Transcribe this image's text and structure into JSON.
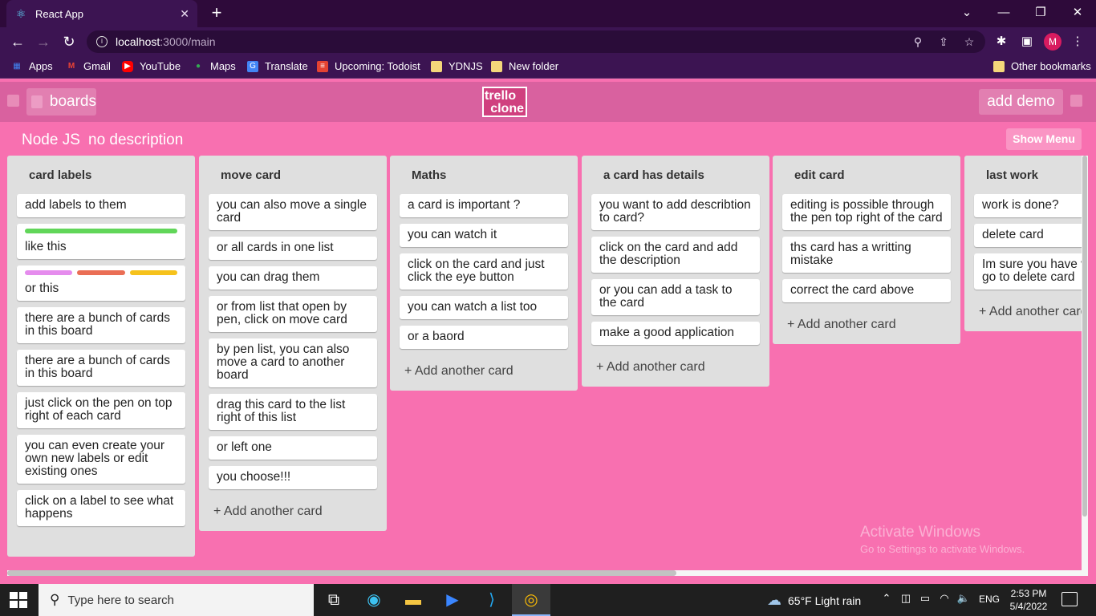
{
  "browser": {
    "tab_title": "React App",
    "url_host": "localhost",
    "url_path": ":3000/main",
    "profile_initial": "M"
  },
  "bookmarks": [
    {
      "label": "Apps",
      "icon": "apps-grid-icon",
      "color": "#4285f4"
    },
    {
      "label": "Gmail",
      "icon": "gmail-icon",
      "color": "#ea4335"
    },
    {
      "label": "YouTube",
      "icon": "youtube-icon",
      "color": "#ff0000"
    },
    {
      "label": "Maps",
      "icon": "maps-pin-icon",
      "color": "#34a853"
    },
    {
      "label": "Translate",
      "icon": "translate-icon",
      "color": "#4285f4"
    },
    {
      "label": "Upcoming: Todoist",
      "icon": "todoist-icon",
      "color": "#e44332"
    },
    {
      "label": "YDNJS",
      "icon": "folder-icon",
      "color": "#f4c542"
    },
    {
      "label": "New folder",
      "icon": "folder-icon",
      "color": "#f4c542"
    }
  ],
  "other_bookmarks": "Other bookmarks",
  "app": {
    "boards_label": "boards",
    "logo_line1": "trello",
    "logo_line2": "clone",
    "add_demo_label": "add demo",
    "board_name": "Node JS",
    "board_description": "no description",
    "show_menu_label": "Show Menu",
    "add_card_label": "+ Add another card"
  },
  "lists": [
    {
      "title": "card labels",
      "cards": [
        {
          "text": "add labels to them"
        },
        {
          "text": "like this",
          "labels": [
            "#61d659"
          ]
        },
        {
          "text": "or this",
          "labels": [
            "#e58ced",
            "#ea6e55",
            "#f6c21c"
          ]
        },
        {
          "text": "there are a bunch of cards in this board"
        },
        {
          "text": "there are a bunch of cards in this board"
        },
        {
          "text": "just click on the pen on top right of each card"
        },
        {
          "text": "you can even create your own new labels or edit existing ones"
        },
        {
          "text": "click on a label to see what happens"
        }
      ],
      "show_add": false
    },
    {
      "title": "move card",
      "cards": [
        {
          "text": "you can also move a single card"
        },
        {
          "text": "or all cards in one list"
        },
        {
          "text": "you can drag them"
        },
        {
          "text": "or from list that open by pen, click on move card"
        },
        {
          "text": "by pen list, you can also move a card to another board"
        },
        {
          "text": "drag this card to the list right of this list"
        },
        {
          "text": "or left one"
        },
        {
          "text": "you choose!!!"
        }
      ],
      "show_add": true
    },
    {
      "title": "Maths",
      "cards": [
        {
          "text": "a card is important ?"
        },
        {
          "text": "you can watch it"
        },
        {
          "text": "click on the card and just click the eye button"
        },
        {
          "text": "you can watch a list too"
        },
        {
          "text": "or a baord"
        }
      ],
      "show_add": true
    },
    {
      "title": "a card has details",
      "cards": [
        {
          "text": "you want to add describtion to card?"
        },
        {
          "text": "click on the card and add the description"
        },
        {
          "text": "or you can add a task to the card"
        },
        {
          "text": "make a good application"
        }
      ],
      "show_add": true
    },
    {
      "title": "edit card",
      "cards": [
        {
          "text": "editing is possible through the pen top right of the card"
        },
        {
          "text": "ths card has a writting mistake"
        },
        {
          "text": "correct the card above"
        }
      ],
      "show_add": true
    },
    {
      "title": "last work",
      "cards": [
        {
          "text": "work is done?"
        },
        {
          "text": "delete card"
        },
        {
          "text": "Im sure you have where to go to delete card"
        }
      ],
      "show_add": true
    }
  ],
  "watermark": {
    "line1": "Activate Windows",
    "line2": "Go to Settings to activate Windows."
  },
  "taskbar": {
    "search_placeholder": "Type here to search",
    "weather": "65°F  Light rain",
    "language": "ENG",
    "time": "2:53 PM",
    "date": "5/4/2022"
  }
}
